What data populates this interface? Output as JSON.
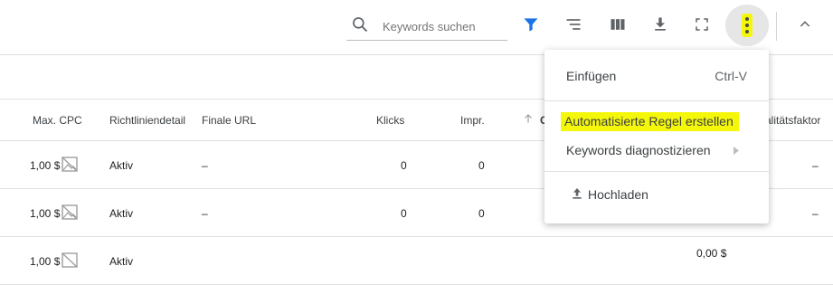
{
  "toolbar": {
    "search_placeholder": "Keywords suchen"
  },
  "table": {
    "headers": {
      "max_cpc": "Max. CPC",
      "policy": "Richtliniendetail",
      "final_url": "Finale URL",
      "clicks": "Klicks",
      "impressions": "Impr.",
      "sorted_col_partial": "C",
      "quality": "alitätsfaktor"
    },
    "rows": [
      {
        "max_cpc": "1,00 $",
        "policy": "Aktiv",
        "final_url": "–",
        "clicks": "0",
        "impressions": "0",
        "quality": "–"
      },
      {
        "max_cpc": "1,00 $",
        "policy": "Aktiv",
        "final_url": "–",
        "clicks": "0",
        "impressions": "0",
        "quality": "–"
      },
      {
        "max_cpc": "1,00 $",
        "policy": "Aktiv",
        "final_url": "",
        "clicks": "",
        "impressions": "",
        "extra": "0,00 $"
      }
    ]
  },
  "menu": {
    "paste": "Einfügen",
    "paste_shortcut": "Ctrl-V",
    "create_rule": "Automatisierte Regel erstellen",
    "diagnose": "Keywords diagnostizieren",
    "upload": "Hochladen"
  },
  "colors": {
    "highlight": "#f4f70a",
    "filter_blue": "#1a73e8",
    "icon_gray": "#5f6368"
  }
}
